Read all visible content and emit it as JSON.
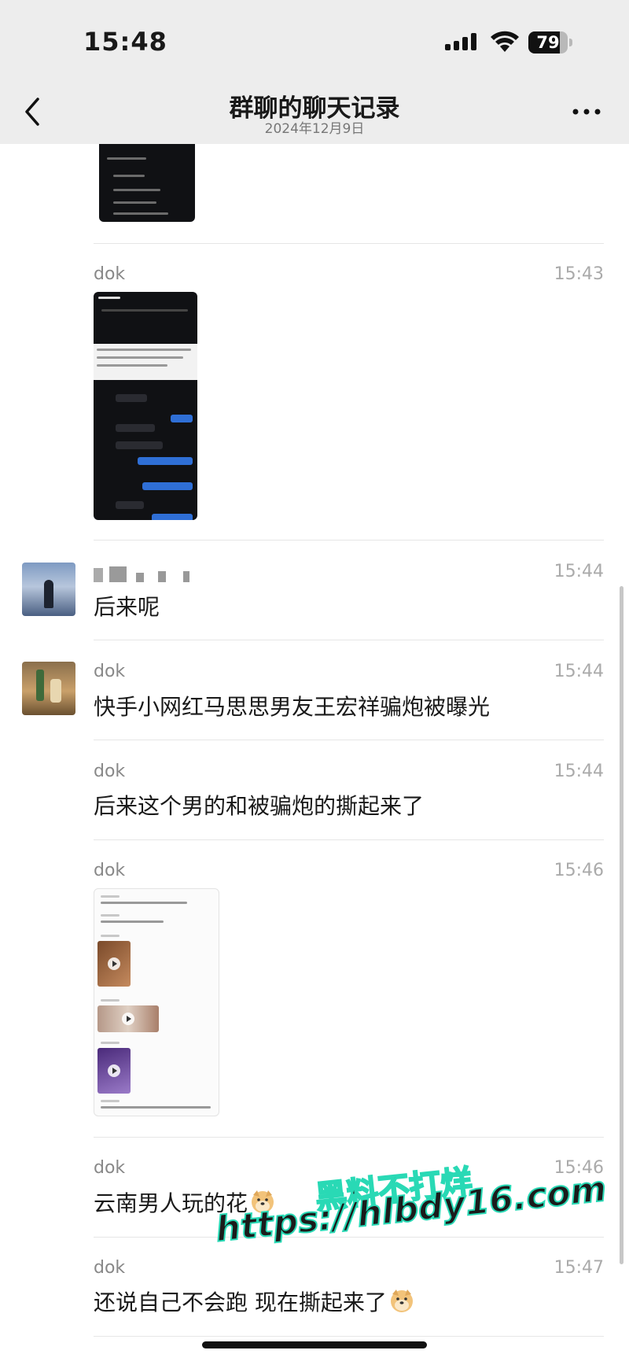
{
  "status_bar": {
    "time": "15:48",
    "battery": "79",
    "battery_level": 0.79
  },
  "nav": {
    "title": "群聊的聊天记录",
    "subtitle": "2024年12月9日"
  },
  "messages": [
    {
      "sender": "dok",
      "time": "15:43",
      "type": "image"
    },
    {
      "sender": "",
      "time": "15:44",
      "text": "后来呢"
    },
    {
      "sender": "dok",
      "time": "15:44",
      "text": "快手小网红马思思男友王宏祥骗炮被曝光"
    },
    {
      "sender": "dok",
      "time": "15:44",
      "text": "后来这个男的和被骗炮的撕起来了"
    },
    {
      "sender": "dok",
      "time": "15:46",
      "type": "image"
    },
    {
      "sender": "dok",
      "time": "15:46",
      "text": "云南男人玩的花",
      "emoji": "doge-emoji"
    },
    {
      "sender": "dok",
      "time": "15:47",
      "text": "还说自己不会跑 现在撕起来了",
      "emoji": "doge-emoji"
    }
  ],
  "watermark": {
    "line1": "黑料不打烊",
    "line2": "https://hlbdy16.com"
  },
  "colors": {
    "accent": "#2f6fd6",
    "watermark": "#29d9b5",
    "header_bg": "#ededed"
  },
  "icons": [
    "back-chevron-icon",
    "more-icon",
    "signal-icon",
    "wifi-icon",
    "battery-icon"
  ]
}
